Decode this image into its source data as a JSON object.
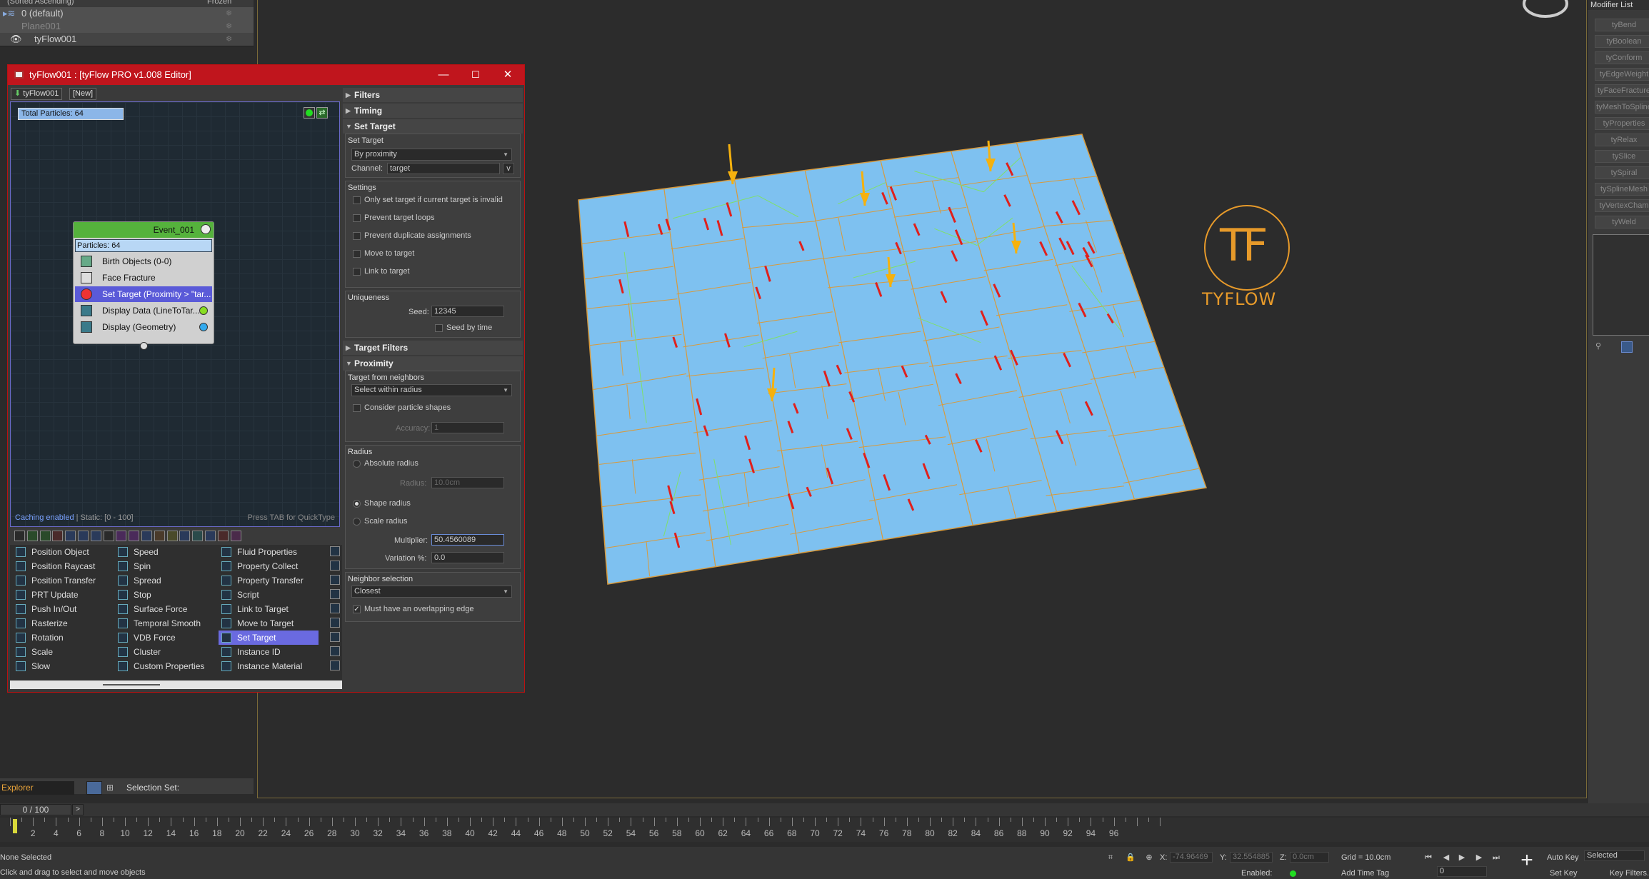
{
  "scene_explorer": {
    "header": "(Sorted Ascending)",
    "header_right": "Frozen",
    "rows": [
      {
        "label": "0 (default)"
      },
      {
        "label": "Plane001"
      },
      {
        "label": "tyFlow001"
      }
    ]
  },
  "editor": {
    "title": "tyFlow001 : [tyFlow PRO v1.008 Editor]",
    "tabs": [
      "tyFlow001",
      "[New]"
    ],
    "total_particles": "Total Particles: 64",
    "caching": "Caching enabled",
    "static_range": " | Static: [0 - 100]",
    "tab_hint": "Press TAB for QuickType",
    "event": {
      "name": "Event_001",
      "particles": "Particles: 64",
      "operators": [
        "Birth Objects (0-0)",
        "Face Fracture",
        "Set Target (Proximity > \"tar...",
        "Display Data (LineToTar...",
        "Display (Geometry)"
      ]
    },
    "operator_list": {
      "col1": [
        "Position Object",
        "Position Raycast",
        "Position Transfer",
        "PRT Update",
        "Push In/Out",
        "Rasterize",
        "Rotation",
        "Scale",
        "Slow"
      ],
      "col2": [
        "Speed",
        "Spin",
        "Spread",
        "Stop",
        "Surface Force",
        "Temporal Smooth",
        "VDB Force",
        "Cluster",
        "Custom Properties"
      ],
      "col3": [
        "Fluid Properties",
        "Property Collect",
        "Property Transfer",
        "Script",
        "Link to Target",
        "Move to Target",
        "Set Target",
        "Instance ID",
        "Instance Material"
      ]
    },
    "rollouts": {
      "filters": "Filters",
      "timing": "Timing",
      "set_target": "Set Target",
      "set_target_group": "Set Target",
      "by_proximity": "By proximity",
      "channel_label": "Channel:",
      "channel_value": "target",
      "channel_btn": "v",
      "settings_group": "Settings",
      "settings": [
        "Only set target if current target is invalid",
        "Prevent target loops",
        "Prevent duplicate assignments",
        "Move to target",
        "Link to target"
      ],
      "uniqueness_group": "Uniqueness",
      "seed_label": "Seed:",
      "seed_value": "12345",
      "seed_by_time": "Seed by time",
      "target_filters": "Target Filters",
      "proximity": "Proximity",
      "target_from_neighbors": "Target from neighbors",
      "select_within_radius": "Select within radius",
      "consider_shapes": "Consider particle shapes",
      "accuracy_label": "Accuracy:",
      "accuracy_value": "1",
      "radius_group": "Radius",
      "absolute_radius": "Absolute radius",
      "radius_label": "Radius:",
      "radius_value": "10.0cm",
      "shape_radius": "Shape radius",
      "scale_radius": "Scale radius",
      "multiplier_label": "Multiplier:",
      "multiplier_value": "50.4560089",
      "variation_label": "Variation %:",
      "variation_value": "0.0",
      "neighbor_group": "Neighbor selection",
      "neighbor_value": "Closest",
      "overlapping_edge": "Must have an overlapping edge"
    }
  },
  "viewport": {
    "logo_text": "TYFLOW",
    "logo_mark": "TF"
  },
  "modifier_panel": {
    "title": "Modifier List",
    "items": [
      "tyBend",
      "tyBoolean",
      "tyConform",
      "tyEdgeWeight",
      "tyFaceFracture",
      "tyMeshToSpline",
      "tyProperties",
      "tyRelax",
      "tySlice",
      "tySpiral",
      "tySplineMesh",
      "tyVertexCham",
      "tyWeld"
    ]
  },
  "bottom": {
    "explorer": "Explorer",
    "selection_set": "Selection Set:",
    "time_display": "0 / 100",
    "time_fwd": ">",
    "ticks": [
      2,
      4,
      6,
      8,
      10,
      12,
      14,
      16,
      18,
      20,
      22,
      24,
      26,
      28,
      30,
      32,
      34,
      36,
      38,
      40,
      42,
      44,
      46,
      48,
      50,
      52,
      54,
      56,
      58,
      60,
      62,
      64,
      66,
      68,
      70,
      72,
      74,
      76,
      78,
      80,
      82,
      84,
      86,
      88,
      90,
      92,
      94,
      96
    ],
    "status": "None Selected",
    "hint": "Click and drag to select and move objects",
    "x_label": "X:",
    "x_value": "-74.96469",
    "y_label": "Y:",
    "y_value": "32.554885",
    "z_label": "Z:",
    "z_value": "0.0cm",
    "grid": "Grid = 10.0cm",
    "enabled": "Enabled:",
    "add_time_tag": "Add Time Tag",
    "auto_key": "Auto Key",
    "set_key": "Set Key",
    "selected": "Selected",
    "key_filters": "Key Filters...",
    "frame": "0"
  },
  "colors": {
    "titlebar": "#c0151d",
    "plane": "#7ec1f0",
    "grid_lines": "#d89a3c",
    "fragments": "#e0201c",
    "arrows": "#f5b10e",
    "logo": "#e79a2a"
  }
}
